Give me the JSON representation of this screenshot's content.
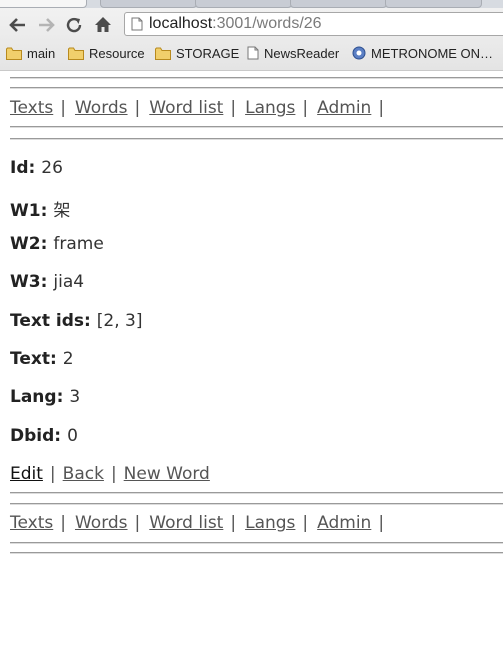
{
  "browser": {
    "url_host": "localhost",
    "url_rest": ":3001/words/26",
    "bookmarks": [
      {
        "label": "main",
        "icon": "folder-icon"
      },
      {
        "label": "Resource",
        "icon": "folder-icon"
      },
      {
        "label": "STORAGE",
        "icon": "folder-icon"
      },
      {
        "label": "NewsReader",
        "icon": "page-icon"
      },
      {
        "label": "METRONOME ON…",
        "icon": "metronome-icon"
      }
    ]
  },
  "menu": {
    "items": [
      {
        "label": "Texts"
      },
      {
        "label": "Words"
      },
      {
        "label": "Word list"
      },
      {
        "label": "Langs"
      },
      {
        "label": "Admin"
      }
    ],
    "separator": "|"
  },
  "record": {
    "fields": [
      {
        "label": "Id:",
        "value": "26"
      },
      {
        "label": "W1:",
        "value": "架"
      },
      {
        "label": "W2:",
        "value": "frame"
      },
      {
        "label": "W3:",
        "value": "jia4"
      },
      {
        "label": "Text ids:",
        "value": "[2, 3]"
      },
      {
        "label": "Text:",
        "value": "2"
      },
      {
        "label": "Lang:",
        "value": "3"
      },
      {
        "label": "Dbid:",
        "value": "0"
      }
    ]
  },
  "actions": {
    "edit": "Edit",
    "back": "Back",
    "new_word": "New Word",
    "separator": "|"
  }
}
